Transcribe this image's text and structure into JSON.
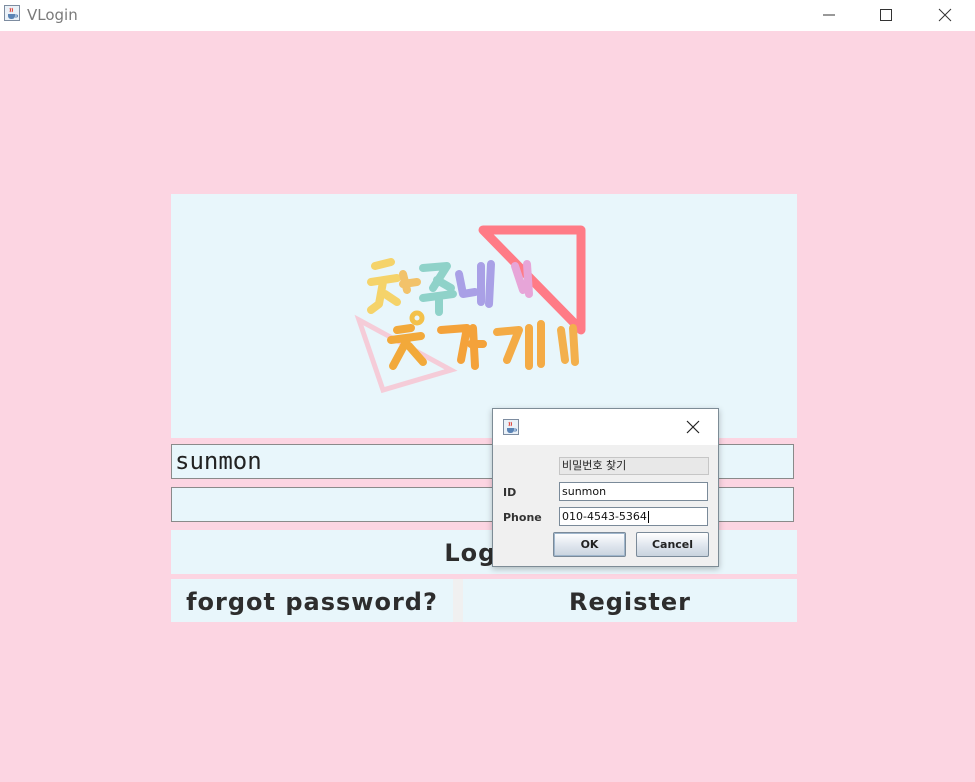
{
  "window": {
    "title": "VLogin",
    "icon": "java-cup-icon"
  },
  "login": {
    "username_value": "sunmon",
    "password_value": "",
    "login_label": "Login",
    "forgot_label": "forgot password?",
    "register_label": "Register"
  },
  "dialog": {
    "heading": "비밀번호 찾기",
    "id_label": "ID",
    "id_value": "sunmon",
    "phone_label": "Phone",
    "phone_value": "010-4543-5364",
    "ok_label": "OK",
    "cancel_label": "Cancel"
  },
  "colors": {
    "background": "#fcd5e2",
    "panel": "#e8f6fb"
  }
}
